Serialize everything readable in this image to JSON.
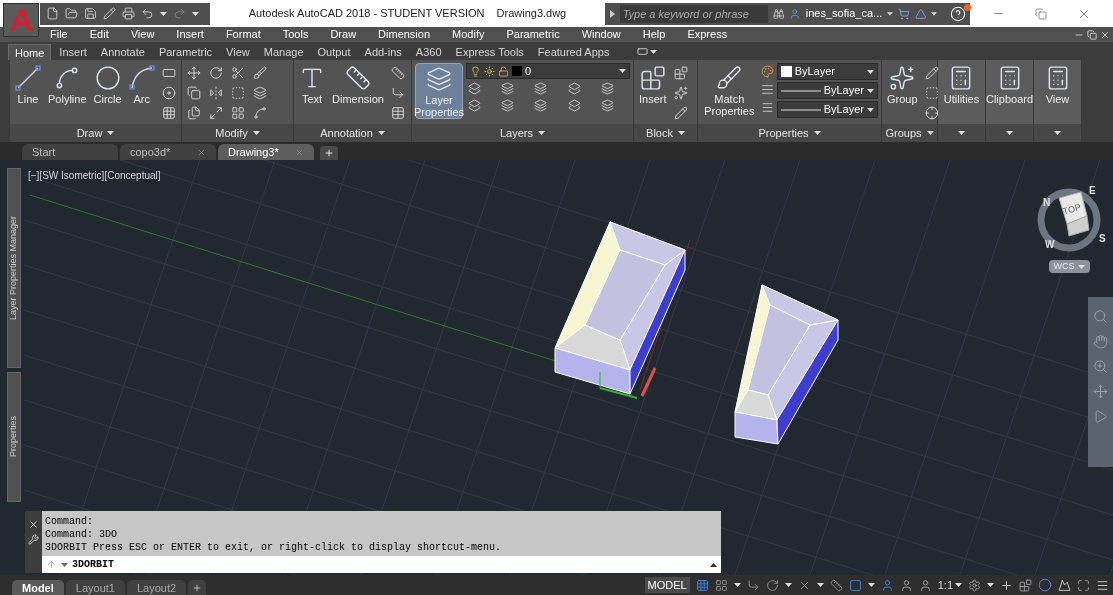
{
  "title_bar": {
    "app": "Autodesk AutoCAD 2018 - STUDENT VERSION",
    "file": "Drawing3.dwg"
  },
  "search": {
    "placeholder": "Type a keyword or phrase"
  },
  "user": {
    "name": "ines_sofia_ca..."
  },
  "menu": [
    "File",
    "Edit",
    "View",
    "Insert",
    "Format",
    "Tools",
    "Draw",
    "Dimension",
    "Modify",
    "Parametric",
    "Window",
    "Help",
    "Express"
  ],
  "ribbon_tabs": [
    {
      "label": "Home",
      "selected": true
    },
    {
      "label": "Insert",
      "selected": false
    },
    {
      "label": "Annotate",
      "selected": false
    },
    {
      "label": "Parametric",
      "selected": false
    },
    {
      "label": "View",
      "selected": false
    },
    {
      "label": "Manage",
      "selected": false
    },
    {
      "label": "Output",
      "selected": false
    },
    {
      "label": "Add-ins",
      "selected": false
    },
    {
      "label": "A360",
      "selected": false
    },
    {
      "label": "Express Tools",
      "selected": false
    },
    {
      "label": "Featured Apps",
      "selected": false
    }
  ],
  "panels": [
    {
      "kind": "draw",
      "title": "Draw",
      "tools": [
        "Line",
        "Polyline",
        "Circle",
        "Arc"
      ]
    },
    {
      "kind": "modify",
      "title": "Modify"
    },
    {
      "kind": "annotation",
      "title": "Annotation",
      "tools": [
        "Text",
        "Dimension"
      ]
    },
    {
      "kind": "layers",
      "title": "Layers",
      "tools": [
        "Layer Properties"
      ],
      "layer": "0"
    },
    {
      "kind": "block",
      "title": "Block",
      "tools": [
        "Insert"
      ]
    },
    {
      "kind": "properties",
      "title": "Properties",
      "tools": [
        "Match Properties"
      ],
      "fields": [
        "ByLayer",
        "ByLayer",
        "ByLayer"
      ]
    },
    {
      "kind": "groups",
      "title": "Groups",
      "tools": [
        "Group"
      ]
    },
    {
      "kind": "collapsed",
      "tools": [
        "Utilities"
      ]
    },
    {
      "kind": "collapsed",
      "tools": [
        "Clipboard"
      ]
    },
    {
      "kind": "collapsed",
      "tools": [
        "View"
      ]
    }
  ],
  "doc_tabs": [
    {
      "label": "Start",
      "selected": false,
      "closable": false
    },
    {
      "label": "copo3d*",
      "selected": false,
      "closable": true
    },
    {
      "label": "Drawing3*",
      "selected": true,
      "closable": true
    }
  ],
  "palettes": [
    "Layer Properties Manager",
    "Properties"
  ],
  "viewport": {
    "label": "[−][SW Isometric][Conceptual]"
  },
  "viewcube": {
    "top": "TOP",
    "compass": [
      "N",
      "E",
      "S",
      "W"
    ],
    "ucs": "WCS"
  },
  "command": {
    "history": [
      "Command:",
      "Command: 3DO",
      "3DORBIT Press ESC or ENTER to exit, or right-click to display shortcut-menu."
    ],
    "input": "3DORBIT"
  },
  "layout_tabs": [
    {
      "label": "Model",
      "selected": true
    },
    {
      "label": "Layout1",
      "selected": false
    },
    {
      "label": "Layout2",
      "selected": false
    }
  ],
  "status": {
    "space": "MODEL",
    "scale": "1:1"
  }
}
